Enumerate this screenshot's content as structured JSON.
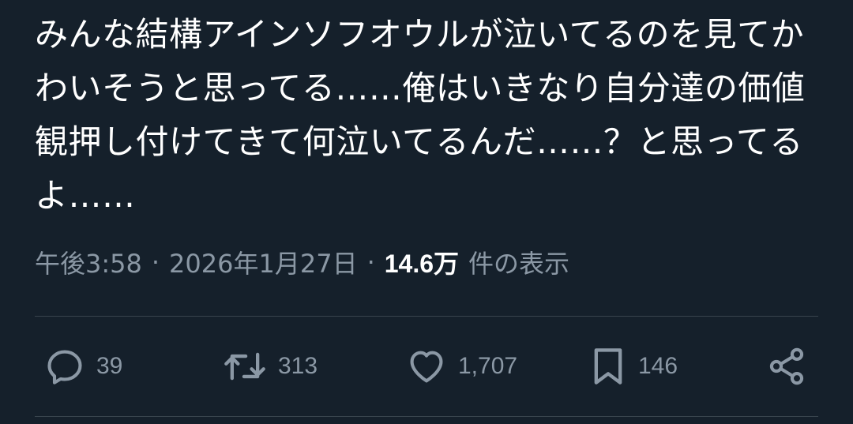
{
  "tweet": {
    "text": "みんな結構アインソフオウルが泣いてるのを見てかわいそうと思ってる……俺はいきなり自分達の価値観押し付けてきて何泣いてるんだ……？と思ってるよ……"
  },
  "meta": {
    "time": "午後3:58",
    "separator": "·",
    "date": "2026年1月27日",
    "views_count": "14.6万",
    "views_label": "件の表示"
  },
  "actions": {
    "reply_count": "39",
    "retweet_count": "313",
    "like_count": "1,707",
    "bookmark_count": "146"
  },
  "colors": {
    "background": "#15202b",
    "text": "#ffffff",
    "secondary": "#8b98a5",
    "divider": "#38444d"
  }
}
